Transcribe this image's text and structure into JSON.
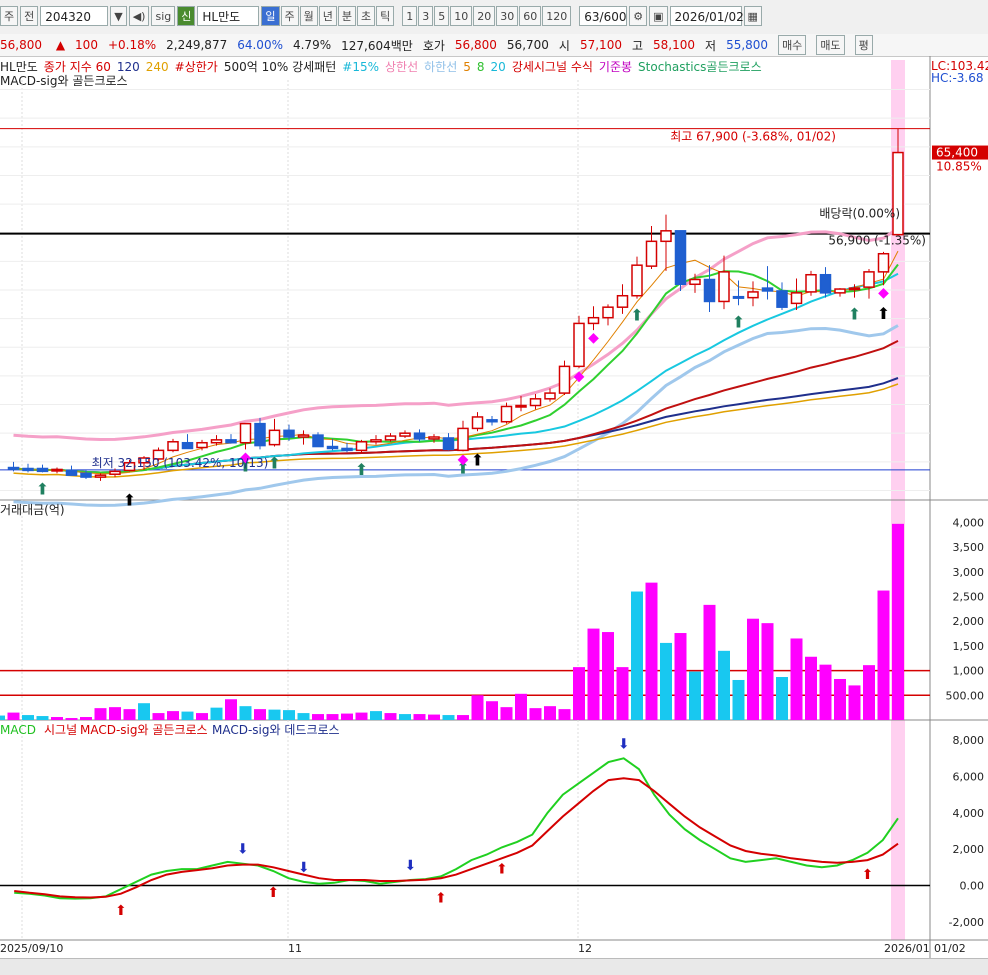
{
  "toolbar": {
    "type_label": "주",
    "prev_label": "전",
    "code": "204320",
    "sig_label": "sig",
    "new_label": "신",
    "name": "HL만도",
    "periods": [
      "일",
      "주",
      "월",
      "년",
      "분",
      "초",
      "틱"
    ],
    "active_period": "일",
    "nums": [
      "1",
      "3",
      "5",
      "10",
      "20",
      "30",
      "60",
      "120"
    ],
    "count": "63/600",
    "date": "2026/01/02"
  },
  "quote": {
    "price": "56,800",
    "change": "100",
    "pct": "+0.18%",
    "volume": "2,249,877",
    "ratio1": "64.00%",
    "ratio2": "4.79%",
    "amount": "127,604백만",
    "bid_label": "호가",
    "bid1": "56,800",
    "bid2": "56,700",
    "open_label": "시",
    "open": "57,100",
    "high_label": "고",
    "high": "58,100",
    "low_label": "저",
    "low": "55,800",
    "buy_label": "매수",
    "sell_label": "매도",
    "flat_label": "평"
  },
  "legend_price": [
    {
      "text": "HL만도",
      "color": "#222222"
    },
    {
      "text": "종가 지수 60",
      "color": "#d40000"
    },
    {
      "text": "120",
      "color": "#1f2f8c"
    },
    {
      "text": "240",
      "color": "#e0a000"
    },
    {
      "text": "#상한가",
      "color": "#d40000"
    },
    {
      "text": "500억 10% 강세패턴",
      "color": "#222222"
    },
    {
      "text": "#15%",
      "color": "#18b8d8"
    },
    {
      "text": "상한선",
      "color": "#f080b0"
    },
    {
      "text": "하한선",
      "color": "#90c0e8"
    },
    {
      "text": "5",
      "color": "#e08000"
    },
    {
      "text": "8",
      "color": "#30c030"
    },
    {
      "text": "20",
      "color": "#18b8d8"
    },
    {
      "text": "강세시그널 수식",
      "color": "#d40000"
    },
    {
      "text": "기준봉",
      "color": "#c000c0"
    },
    {
      "text": "Stochastics골든크로스",
      "color": "#20a060"
    }
  ],
  "legend_price2": "MACD-sig와 골든크로스",
  "legend_volume": "거래대금(억)",
  "legend_macd": [
    {
      "text": "MACD",
      "color": "#20c020"
    },
    {
      "text": "시그널",
      "color": "#d40000"
    },
    {
      "text": "MACD-sig와 골든크로스",
      "color": "#d40000"
    },
    {
      "text": "MACD-sig와 데드크로스",
      "color": "#1f2f8c"
    }
  ],
  "annotations": {
    "high": "최고 67,900 (-3.68%, 01/02)",
    "low": "최저 32,150 (103.42%, 10/13)",
    "dividend": "배당락(0.00%)",
    "mid": "56,900 (-1.35%)",
    "lc": "LC:103.42",
    "hc": "HC:-3.68",
    "price_tag": "65,400",
    "pct_tag": "10.85%"
  },
  "x_labels": [
    "2025/09/10",
    "11",
    "12",
    "2026/01",
    "01/02"
  ],
  "colors": {
    "up": "#d40000",
    "down": "#1f5fd0",
    "vol_up": "#ff00ff",
    "vol_down": "#18c8f0",
    "highlight": "#ffd0f0"
  },
  "chart_data": [
    {
      "type": "candlestick",
      "title": "HL만도",
      "ylabel": "",
      "ylim": [
        29000,
        73000
      ],
      "candles": [
        {
          "o": 32400,
          "h": 33000,
          "l": 32000,
          "c": 32300
        },
        {
          "o": 32300,
          "h": 32800,
          "l": 31900,
          "c": 32100
        },
        {
          "o": 32300,
          "h": 32700,
          "l": 31900,
          "c": 32000
        },
        {
          "o": 32100,
          "h": 32400,
          "l": 31800,
          "c": 32200
        },
        {
          "o": 32100,
          "h": 32600,
          "l": 31700,
          "c": 31600
        },
        {
          "o": 31800,
          "h": 32100,
          "l": 31200,
          "c": 31400
        },
        {
          "o": 31400,
          "h": 31800,
          "l": 31000,
          "c": 31600
        },
        {
          "o": 31700,
          "h": 32300,
          "l": 31400,
          "c": 32000
        },
        {
          "o": 32100,
          "h": 33200,
          "l": 32000,
          "c": 32900
        },
        {
          "o": 32900,
          "h": 33600,
          "l": 32150,
          "c": 33400
        },
        {
          "o": 33300,
          "h": 34500,
          "l": 33100,
          "c": 34200
        },
        {
          "o": 34200,
          "h": 35400,
          "l": 34000,
          "c": 35100
        },
        {
          "o": 35000,
          "h": 35900,
          "l": 34600,
          "c": 34400
        },
        {
          "o": 34500,
          "h": 35300,
          "l": 34200,
          "c": 35000
        },
        {
          "o": 35000,
          "h": 35800,
          "l": 34700,
          "c": 35300
        },
        {
          "o": 35300,
          "h": 35900,
          "l": 34900,
          "c": 35000
        },
        {
          "o": 35000,
          "h": 36200,
          "l": 34300,
          "c": 37000
        },
        {
          "o": 37000,
          "h": 37600,
          "l": 34300,
          "c": 34700
        },
        {
          "o": 34800,
          "h": 37500,
          "l": 34600,
          "c": 36300
        },
        {
          "o": 36300,
          "h": 36900,
          "l": 35200,
          "c": 35600
        },
        {
          "o": 35600,
          "h": 36300,
          "l": 34800,
          "c": 35800
        },
        {
          "o": 35800,
          "h": 36100,
          "l": 34600,
          "c": 34600
        },
        {
          "o": 34600,
          "h": 35400,
          "l": 34200,
          "c": 34400
        },
        {
          "o": 34400,
          "h": 35000,
          "l": 34000,
          "c": 34200
        },
        {
          "o": 34200,
          "h": 35300,
          "l": 33900,
          "c": 35100
        },
        {
          "o": 35100,
          "h": 35800,
          "l": 34800,
          "c": 35300
        },
        {
          "o": 35300,
          "h": 36000,
          "l": 35100,
          "c": 35700
        },
        {
          "o": 35700,
          "h": 36300,
          "l": 35500,
          "c": 36000
        },
        {
          "o": 36000,
          "h": 36400,
          "l": 35100,
          "c": 35400
        },
        {
          "o": 35400,
          "h": 35900,
          "l": 35000,
          "c": 35600
        },
        {
          "o": 35500,
          "h": 36000,
          "l": 34200,
          "c": 34300
        },
        {
          "o": 34200,
          "h": 37300,
          "l": 34100,
          "c": 36500
        },
        {
          "o": 36500,
          "h": 38200,
          "l": 36200,
          "c": 37700
        },
        {
          "o": 37400,
          "h": 37800,
          "l": 36800,
          "c": 37200
        },
        {
          "o": 37200,
          "h": 39200,
          "l": 37000,
          "c": 38800
        },
        {
          "o": 38800,
          "h": 39900,
          "l": 38300,
          "c": 38900
        },
        {
          "o": 38900,
          "h": 40100,
          "l": 38500,
          "c": 39600
        },
        {
          "o": 39600,
          "h": 40700,
          "l": 39300,
          "c": 40200
        },
        {
          "o": 40200,
          "h": 43600,
          "l": 40000,
          "c": 43000
        },
        {
          "o": 43000,
          "h": 48300,
          "l": 42800,
          "c": 47500
        },
        {
          "o": 47500,
          "h": 49300,
          "l": 46800,
          "c": 48100
        },
        {
          "o": 48100,
          "h": 49500,
          "l": 47300,
          "c": 49200
        },
        {
          "o": 49200,
          "h": 51600,
          "l": 48500,
          "c": 50400
        },
        {
          "o": 50400,
          "h": 54500,
          "l": 50100,
          "c": 53600
        },
        {
          "o": 53500,
          "h": 57700,
          "l": 53200,
          "c": 56100
        },
        {
          "o": 56100,
          "h": 58900,
          "l": 53000,
          "c": 57200
        },
        {
          "o": 57200,
          "h": 54800,
          "l": 50900,
          "c": 51600
        },
        {
          "o": 51600,
          "h": 52700,
          "l": 50700,
          "c": 52100
        },
        {
          "o": 52100,
          "h": 53600,
          "l": 48700,
          "c": 49800
        },
        {
          "o": 49800,
          "h": 54600,
          "l": 49000,
          "c": 52900
        },
        {
          "o": 50300,
          "h": 52000,
          "l": 49400,
          "c": 50200
        },
        {
          "o": 50200,
          "h": 51900,
          "l": 49300,
          "c": 50800
        },
        {
          "o": 51200,
          "h": 53500,
          "l": 50000,
          "c": 50900
        },
        {
          "o": 50900,
          "h": 51800,
          "l": 48900,
          "c": 49200
        },
        {
          "o": 49600,
          "h": 52200,
          "l": 48900,
          "c": 50700
        },
        {
          "o": 50800,
          "h": 53000,
          "l": 50400,
          "c": 52600
        },
        {
          "o": 52600,
          "h": 53400,
          "l": 50200,
          "c": 50700
        },
        {
          "o": 50700,
          "h": 51200,
          "l": 50300,
          "c": 51100
        },
        {
          "o": 51100,
          "h": 51600,
          "l": 50200,
          "c": 51200
        },
        {
          "o": 51300,
          "h": 53200,
          "l": 50100,
          "c": 52900
        },
        {
          "o": 52900,
          "h": 55000,
          "l": 51500,
          "c": 54800
        },
        {
          "o": 56800,
          "h": 67900,
          "l": 56800,
          "c": 65400
        }
      ]
    },
    {
      "type": "bar",
      "title": "거래대금(억)",
      "ylim": [
        0,
        4250
      ],
      "values": [
        60,
        50,
        90,
        150,
        100,
        80,
        60,
        40,
        60,
        240,
        260,
        220,
        340,
        140,
        180,
        170,
        140,
        250,
        420,
        280,
        220,
        210,
        200,
        140,
        120,
        120,
        130,
        150,
        180,
        140,
        120,
        120,
        110,
        100,
        100,
        500,
        380,
        260,
        530,
        240,
        280,
        220,
        1070,
        1850,
        1780,
        1070,
        2600,
        2780,
        1560,
        1760,
        980,
        2330,
        1400,
        810,
        2050,
        1960,
        870,
        1650,
        1280,
        1120,
        830,
        700,
        1110,
        2620,
        3970
      ],
      "hlines": [
        1000,
        500
      ]
    },
    {
      "type": "line",
      "title": "MACD",
      "ylim": [
        -3000,
        9000
      ],
      "series": [
        {
          "name": "MACD",
          "values": [
            -400,
            -450,
            -550,
            -700,
            -720,
            -700,
            -600,
            -200,
            200,
            600,
            800,
            900,
            900,
            1100,
            1300,
            1200,
            1100,
            800,
            400,
            200,
            100,
            150,
            300,
            250,
            100,
            200,
            300,
            350,
            500,
            900,
            1400,
            1700,
            2100,
            2400,
            2800,
            4000,
            5000,
            5600,
            6200,
            6800,
            7000,
            6400,
            5000,
            3900,
            3100,
            2500,
            2000,
            1500,
            1300,
            1400,
            1500,
            1300,
            1100,
            1000,
            1100,
            1400,
            1800,
            2500,
            3700
          ]
        },
        {
          "name": "시그널",
          "values": [
            -300,
            -400,
            -480,
            -600,
            -650,
            -660,
            -620,
            -450,
            -100,
            300,
            600,
            750,
            850,
            950,
            1100,
            1150,
            1150,
            1000,
            800,
            600,
            400,
            300,
            300,
            300,
            250,
            250,
            280,
            320,
            400,
            600,
            900,
            1200,
            1500,
            1800,
            2200,
            3000,
            3800,
            4500,
            5200,
            5800,
            5900,
            5800,
            5200,
            4500,
            3800,
            3200,
            2700,
            2200,
            1900,
            1750,
            1650,
            1500,
            1400,
            1300,
            1250,
            1300,
            1400,
            1700,
            2300
          ]
        }
      ]
    }
  ]
}
